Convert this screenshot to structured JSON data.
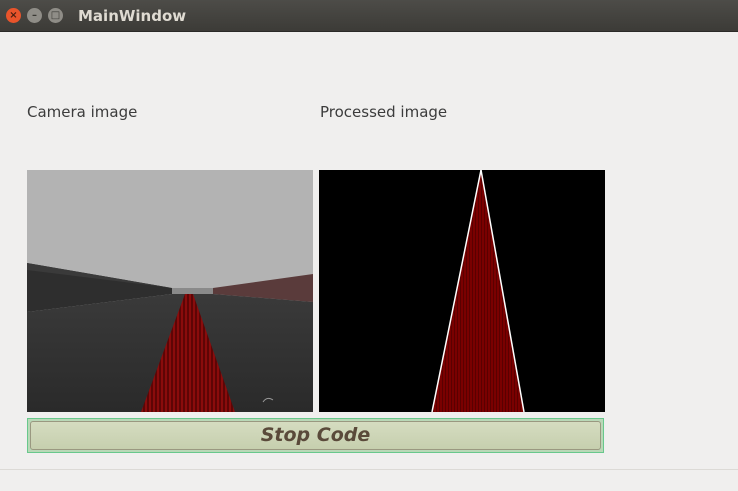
{
  "window": {
    "title": "MainWindow",
    "close_glyph": "×",
    "minimize_glyph": "–",
    "maximize_glyph": "□"
  },
  "labels": {
    "camera": "Camera image",
    "processed": "Processed image"
  },
  "stop_button": {
    "label": "Stop Code"
  },
  "icons": [
    "close-icon",
    "minimize-icon",
    "maximize-icon"
  ],
  "colors": {
    "close_button": "#e9542b",
    "track_red": "#8b0000",
    "stop_button_border": "#68c88c",
    "stop_button_fill": "#c6cfae"
  }
}
